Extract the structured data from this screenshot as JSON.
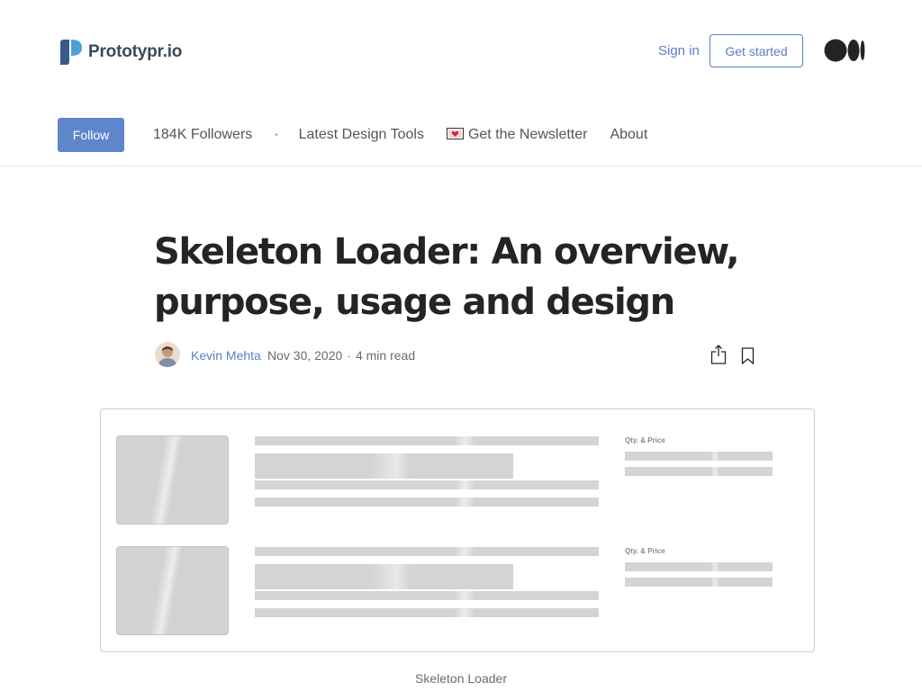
{
  "header": {
    "brand": "Prototypr.io",
    "sign_in": "Sign in",
    "get_started": "Get started",
    "colors": {
      "brand_dark": "#3b4a5a",
      "brand_light": "#4fa0d8",
      "link": "#5a7ec4",
      "follow_bg": "#5f85cb"
    }
  },
  "nav": {
    "follow": "Follow",
    "followers": "184K Followers",
    "separator": "·",
    "links": [
      "Latest Design Tools",
      "Get the Newsletter",
      "About"
    ],
    "newsletter_icon": "love-letter-icon"
  },
  "article": {
    "title": "Skeleton Loader: An overview, purpose, usage and design",
    "author": "Kevin Mehta",
    "date": "Nov 30, 2020",
    "read_time": "4 min read",
    "separator": "·",
    "figure": {
      "qty_label_1": "Qty. & Price",
      "qty_label_2": "Qty. & Price",
      "caption": "Skeleton Loader"
    }
  }
}
